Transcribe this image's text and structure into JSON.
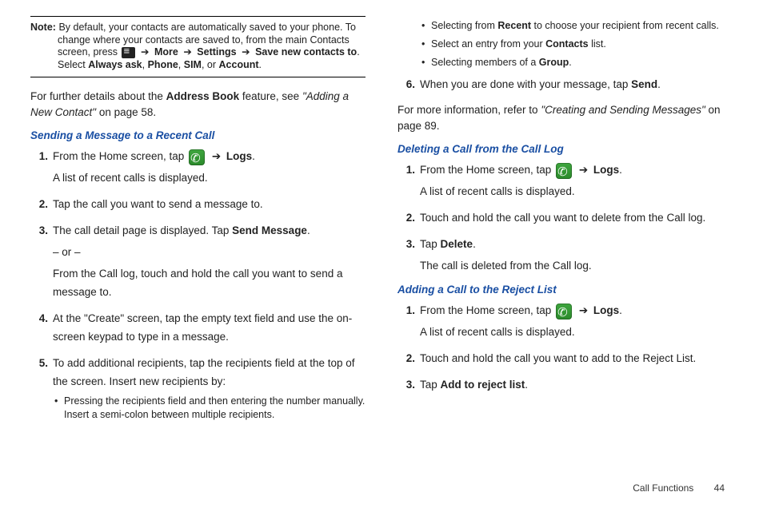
{
  "note": {
    "label": "Note:",
    "l1a": "By default, your contacts are automatically saved to your phone. To",
    "l2": "change where your contacts are saved to, from the main Contacts",
    "l3a": "screen, press ",
    "more": "More",
    "settings": "Settings",
    "savenew": "Save new contacts to",
    "l4a": "Select ",
    "always": "Always ask",
    "phone": "Phone",
    "sim": "SIM",
    "or": ", or ",
    "account": "Account"
  },
  "intro": {
    "a": "For further details about the ",
    "ab": "Address Book",
    "b": " feature, see ",
    "ref": "\"Adding a New Contact\"",
    "c": " on page 58."
  },
  "sec1": {
    "title": "Sending a Message to a Recent Call",
    "s1a": "From the Home screen, tap ",
    "logs": "Logs",
    "s1b": "A list of recent calls is displayed.",
    "s2": "Tap the call you want to send a message to.",
    "s3a": "The call detail page is displayed. Tap ",
    "sendmsg": "Send Message",
    "or": "– or –",
    "s3b": "From the Call log, touch and hold the call you want to send a message to.",
    "s4": "At the \"Create\" screen, tap the empty text field and use the on-screen keypad to type in a message.",
    "s5": "To add additional recipients, tap the recipients field at the top of the screen. Insert new recipients by:",
    "b1": "Pressing the recipients field and then entering the number manually. Insert a semi-colon between multiple recipients."
  },
  "col2top": {
    "b2a": "Selecting from ",
    "recent": "Recent",
    "b2b": " to choose your recipient from recent calls.",
    "b3a": "Select an entry from your ",
    "contacts": "Contacts",
    "b3b": " list.",
    "b4a": "Selecting members of a ",
    "group": "Group",
    "s6a": "When you are done with your message, tap ",
    "send": "Send"
  },
  "moreinfo": {
    "a": "For more information, refer to ",
    "ref": "\"Creating and Sending Messages\"",
    "b": " on page 89."
  },
  "sec2": {
    "title": "Deleting a Call from the Call Log",
    "s1a": "From the Home screen, tap ",
    "logs": "Logs",
    "s1b": "A list of recent calls is displayed.",
    "s2": "Touch and hold the call you want to delete from the Call log.",
    "s3a": "Tap ",
    "delete": "Delete",
    "s3b": "The call is deleted from the Call log."
  },
  "sec3": {
    "title": "Adding a Call to the Reject List",
    "s1a": "From the Home screen, tap ",
    "logs": "Logs",
    "s1b": "A list of recent calls is displayed.",
    "s2": "Touch and hold the call you want to add to the Reject List.",
    "s3a": "Tap ",
    "addreject": "Add to reject list"
  },
  "footer": {
    "section": "Call Functions",
    "page": "44"
  },
  "arrow": "➔",
  "comma": ", ",
  "period": "."
}
